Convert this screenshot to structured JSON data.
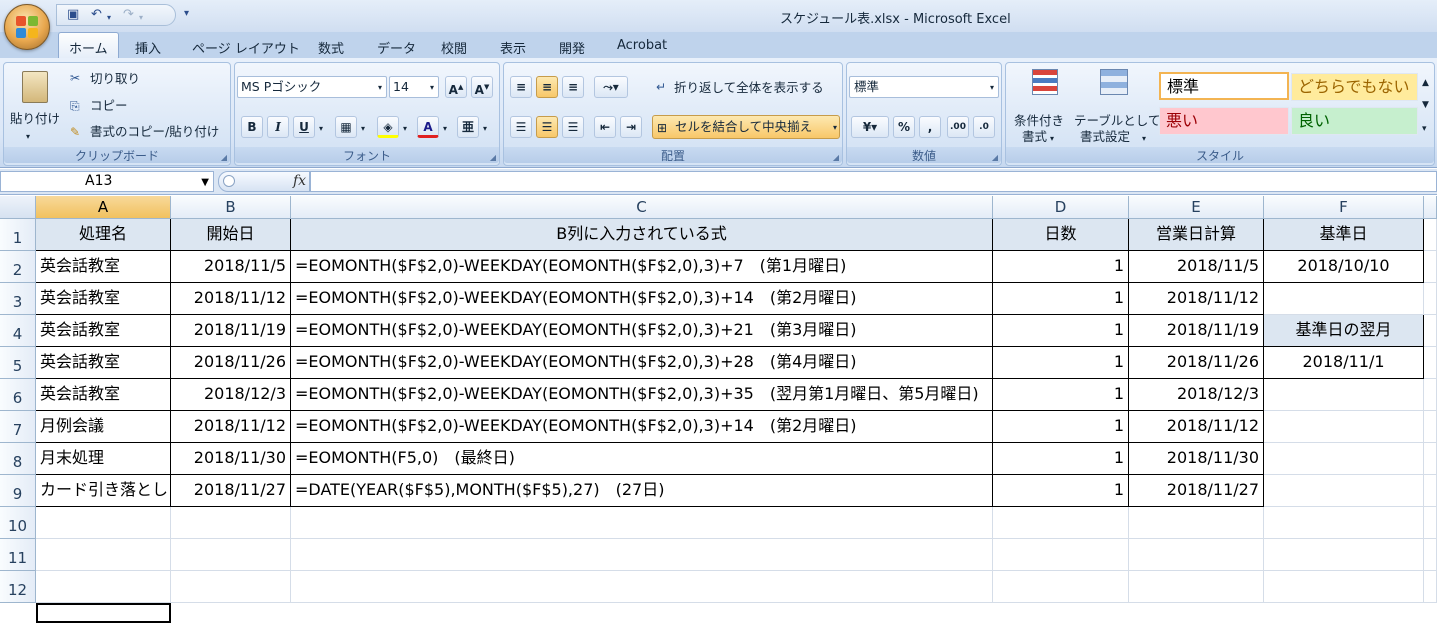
{
  "window": {
    "title": "スケジュール表.xlsx - Microsoft Excel"
  },
  "tabs": [
    "ホーム",
    "挿入",
    "ページ レイアウト",
    "数式",
    "データ",
    "校閲",
    "表示",
    "開発",
    "Acrobat"
  ],
  "ribbon": {
    "clipboard": {
      "paste": "貼り付け",
      "cut": "切り取り",
      "copy": "コピー",
      "format_painter": "書式のコピー/貼り付け",
      "label": "クリップボード"
    },
    "font": {
      "name": "MS Pゴシック",
      "size": "14",
      "label": "フォント"
    },
    "alignment": {
      "wrap": "折り返して全体を表示する",
      "merge": "セルを結合して中央揃え",
      "label": "配置"
    },
    "number": {
      "format": "標準",
      "label": "数値"
    },
    "styles": {
      "conditional": "条件付き",
      "conditional2": "書式",
      "table": "テーブルとして",
      "table2": "書式設定",
      "standard": "標準",
      "neutral": "どちらでもない",
      "bad": "悪い",
      "good": "良い",
      "label": "スタイル"
    }
  },
  "formula_bar": {
    "name_box": "A13",
    "formula": ""
  },
  "sheet": {
    "columns": [
      "A",
      "B",
      "C",
      "D",
      "E",
      "F"
    ],
    "rows": [
      "1",
      "2",
      "3",
      "4",
      "5",
      "6",
      "7",
      "8",
      "9",
      "10",
      "11",
      "12"
    ],
    "header": [
      "処理名",
      "開始日",
      "B列に入力されている式",
      "日数",
      "営業日計算",
      "基準日"
    ],
    "data": [
      [
        "英会話教室",
        "2018/11/5",
        "=EOMONTH($F$2,0)-WEEKDAY(EOMONTH($F$2,0),3)+7　(第1月曜日)",
        "1",
        "2018/11/5",
        "2018/10/10"
      ],
      [
        "英会話教室",
        "2018/11/12",
        "=EOMONTH($F$2,0)-WEEKDAY(EOMONTH($F$2,0),3)+14　(第2月曜日)",
        "1",
        "2018/11/12",
        ""
      ],
      [
        "英会話教室",
        "2018/11/19",
        "=EOMONTH($F$2,0)-WEEKDAY(EOMONTH($F$2,0),3)+21　(第3月曜日)",
        "1",
        "2018/11/19",
        "基準日の翌月"
      ],
      [
        "英会話教室",
        "2018/11/26",
        "=EOMONTH($F$2,0)-WEEKDAY(EOMONTH($F$2,0),3)+28　(第4月曜日)",
        "1",
        "2018/11/26",
        "2018/11/1"
      ],
      [
        "英会話教室",
        "2018/12/3",
        "=EOMONTH($F$2,0)-WEEKDAY(EOMONTH($F$2,0),3)+35　(翌月第1月曜日、第5月曜日)",
        "1",
        "2018/12/3",
        ""
      ],
      [
        "月例会議",
        "2018/11/12",
        "=EOMONTH($F$2,0)-WEEKDAY(EOMONTH($F$2,0),3)+14　(第2月曜日)",
        "1",
        "2018/11/12",
        ""
      ],
      [
        "月末処理",
        "2018/11/30",
        "=EOMONTH(F5,0)　(最終日)",
        "1",
        "2018/11/30",
        ""
      ],
      [
        "カード引き落とし",
        "2018/11/27",
        "=DATE(YEAR($F$5),MONTH($F$5),27)　(27日)",
        "1",
        "2018/11/27",
        ""
      ]
    ]
  },
  "colors": {
    "accent": "#f1c15f",
    "header_fill": "#dce6f1",
    "neutral": "#ffeb9c",
    "bad": "#ffc7ce",
    "good": "#c6efce"
  }
}
